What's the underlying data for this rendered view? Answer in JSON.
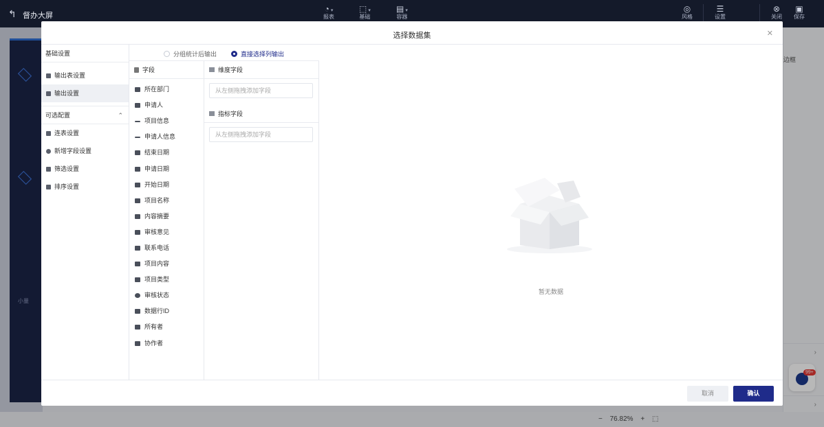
{
  "app": {
    "title": "督办大屏",
    "toolbar": [
      {
        "label": "报表",
        "icon": "chart-icon"
      },
      {
        "label": "基础",
        "icon": "grid-icon"
      },
      {
        "label": "容器",
        "icon": "container-icon"
      }
    ],
    "right_tools": [
      {
        "label": "风格",
        "icon": "palette-icon"
      },
      {
        "label": "设置",
        "icon": "sliders-icon"
      },
      {
        "label": "关闭",
        "icon": "close-circle-icon"
      },
      {
        "label": "保存",
        "icon": "save-icon"
      }
    ]
  },
  "background": {
    "right_panel_frame": "边框",
    "zoom": "76.82%",
    "badge": "99+",
    "canvas_label": "小量"
  },
  "modal": {
    "title": "选择数据集",
    "settings": {
      "basic_header": "基础设置",
      "basic_items": [
        "输出表设置",
        "输出设置"
      ],
      "optional_header": "可选配置",
      "optional_items": [
        "连表设置",
        "新增字段设置",
        "筛选设置",
        "排序设置"
      ]
    },
    "output_mode": {
      "option_grouped": "分组统计后输出",
      "option_direct": "直接选择列输出",
      "selected": "直接选择列输出"
    },
    "fields": {
      "header": "字段",
      "items": [
        "所在部门",
        "申请人",
        "项目信息",
        "申请人信息",
        "结束日期",
        "申请日期",
        "开始日期",
        "项目名称",
        "内容摘要",
        "审核意见",
        "联系电话",
        "项目内容",
        "项目类型",
        "审核状态",
        "数据行ID",
        "所有者",
        "协作者"
      ]
    },
    "dimension": {
      "header": "维度字段",
      "placeholder": "从左侧拖拽添加字段"
    },
    "metric": {
      "header": "指标字段",
      "placeholder": "从左侧拖拽添加字段"
    },
    "preview": {
      "empty_text": "暂无数据"
    },
    "footer": {
      "cancel": "取消",
      "confirm": "确认"
    }
  }
}
